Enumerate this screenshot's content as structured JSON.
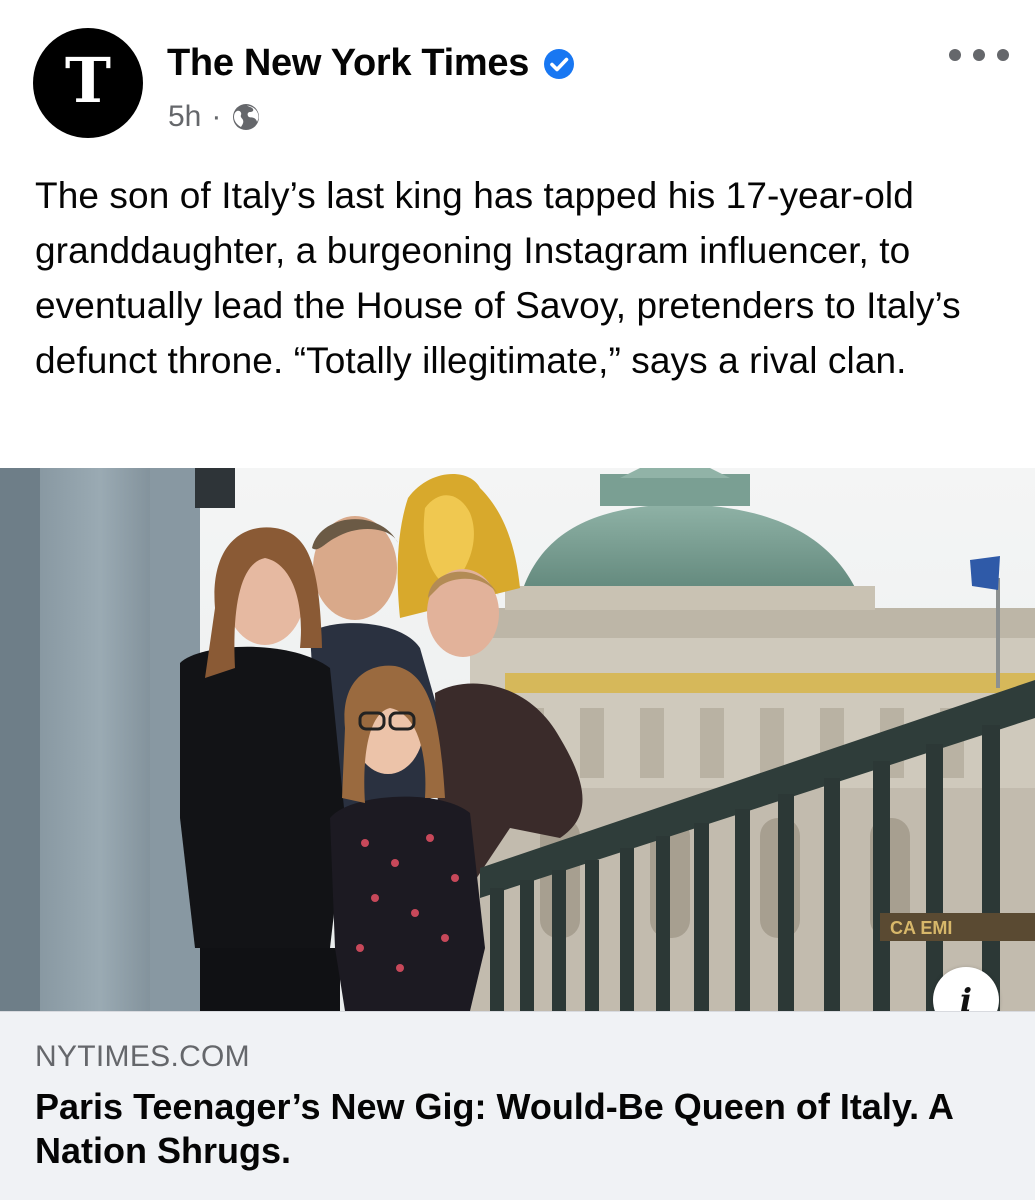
{
  "post": {
    "page_name": "The New York Times",
    "time": "5h",
    "separator": "·",
    "text": "The son of Italy’s last king has tapped his 17-year-old granddaughter, a burgeoning Instagram influencer, to eventually lead the House of Savoy, pretenders to Italy’s defunct throne. “Totally illegitimate,” says a rival clan.",
    "avatar_glyph": "T",
    "verified_icon": "verified-badge-icon",
    "audience_icon": "globe-icon",
    "more_icon": "more-options-icon"
  },
  "media": {
    "info_label": "i",
    "signage_text": "CA    EMI"
  },
  "link": {
    "domain": "NYTIMES.COM",
    "title": "Paris Teenager’s New Gig: Would-Be Queen of Italy. A Nation Shrugs."
  },
  "colors": {
    "verified": "#1877f2",
    "meta_text": "#65676b",
    "card_bg": "#f0f2f5"
  }
}
